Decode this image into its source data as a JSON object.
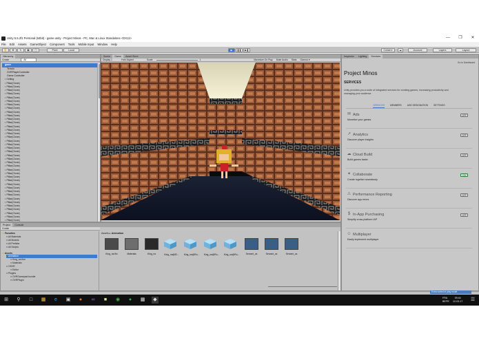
{
  "window": {
    "title": "Unity 5.5.2f1 Personal (64bit) - game.unity - Project Minos - PC, Mac & Linux Standalone <DX11>",
    "controls": [
      "—",
      "❐",
      "✕"
    ]
  },
  "menu": [
    "File",
    "Edit",
    "Assets",
    "GameObject",
    "Component",
    "Tools",
    "Mobile Input",
    "Window",
    "Help"
  ],
  "toolbar": {
    "pivot": "Pivot",
    "local": "Local",
    "collab": "Collab ▾",
    "account": "Account",
    "layers": "Layers",
    "layout": "Layout"
  },
  "hierarchy": {
    "tab": "Hierarchy",
    "create": "Create",
    "search_placeholder": "All",
    "scene": "game",
    "items": [
      "Terrain",
      "OVRPlayerController",
      "Game Controller",
      "Ceiling",
      "Pillar(Clone)",
      "Pillar(Clone)",
      "Pillar(Clone)",
      "Pillar(Clone)",
      "Pillar(Clone)",
      "Pillar(Clone)",
      "Pillar(Clone)",
      "Pillar(Clone)",
      "Pillar(Clone)",
      "Pillar(Clone)",
      "Pillar(Clone)",
      "Pillar(Clone)",
      "Pillar(Clone)",
      "Pillar(Clone)",
      "Pillar(Clone)",
      "Pillar(Clone)",
      "Pillar(Clone)",
      "Pillar(Clone)",
      "Pillar(Clone)",
      "Pillar(Clone)",
      "Pillar(Clone)",
      "Pillar(Clone)",
      "Pillar(Clone)",
      "Pillar(Clone)",
      "Pillar(Clone)",
      "Pillar(Clone)",
      "Pillar(Clone)",
      "Pillar(Clone)",
      "Pillar(Clone)",
      "Pillar(Clone)",
      "Pillar(Clone)",
      "Pillar(Clone)",
      "Pillar(Clone)",
      "Pillar(Clone)",
      "Pillar(Clone)",
      "Pillar(Clone)",
      "Pillar(Clone)",
      "Pillar(Clone)",
      "Pillar(Clone)"
    ]
  },
  "center": {
    "tabs": [
      "Scene",
      "Game",
      "Asset Store"
    ],
    "display": "Display 1",
    "aspect": "Free Aspect",
    "scale_label": "Scale",
    "scale_value": "1",
    "options": [
      "Maximize On Play",
      "Mute Audio",
      "Stats",
      "Gizmos ▾"
    ]
  },
  "right": {
    "tabs": [
      "Inspector",
      "Lighting",
      "Services"
    ],
    "go_to_dashboard": "Go to Dashboard",
    "project_name": "Project Minos",
    "section": "SERVICES",
    "intro": "Unity provides you a suite of integrated services for creating games, increasing productivity and managing your audience.",
    "subtabs": [
      "SERVICES",
      "MEMBERS",
      "AGE DESIGNATION",
      "SETTINGS"
    ],
    "services": [
      {
        "name": "Ads",
        "desc": "Monetize your games",
        "state": "OFF",
        "icon": "ads-icon"
      },
      {
        "name": "Analytics",
        "desc": "Discover player insights",
        "state": "OFF",
        "icon": "analytics-icon"
      },
      {
        "name": "Cloud Build",
        "desc": "Build games faster",
        "state": "OFF",
        "icon": "cloud-build-icon"
      },
      {
        "name": "Collaborate",
        "desc": "Create together seamlessly",
        "state": "ON",
        "icon": "collaborate-icon"
      },
      {
        "name": "Performance Reporting",
        "desc": "Discover app errors",
        "state": "OFF",
        "icon": "performance-icon"
      },
      {
        "name": "In-App Purchasing",
        "desc": "Simplify cross-platform IAP",
        "state": "OFF",
        "icon": "iap-icon"
      },
      {
        "name": "Multiplayer",
        "desc": "Easily implement multiplayer",
        "state": "",
        "icon": "multiplayer-icon"
      }
    ]
  },
  "project": {
    "tabs": [
      "Project",
      "Console"
    ],
    "create": "Create",
    "breadcrumb": [
      "Assets",
      "Animation"
    ],
    "favorites_header": "Favorites",
    "favorites": [
      "All Materials",
      "All Models",
      "All Prefabs",
      "All Scripts"
    ],
    "assets_header": "Assets",
    "folders": [
      "Animation",
      "King_na.fbm",
      "Materials",
      "OSVR",
      "Editor",
      "Plugins",
      "OVRGamepad.bundle",
      "OVRPlugin"
    ],
    "assets": [
      "King_na.fbx",
      "Materials",
      "King_na",
      "King_na@El...",
      "King_na@Ru...",
      "King_na@Ru...",
      "King_na@Ru...",
      "Servant_ca",
      "Servant_ca",
      "Servant_ca"
    ]
  },
  "taskbar": {
    "lang": "FRA",
    "layout": "BEFR",
    "time": "09:44",
    "date": "12-03-17",
    "notification": "Extra sorted in play mode"
  },
  "colors": {
    "editor_bg": "#c2c2c2",
    "selection": "#3e7ad0",
    "play_button": "#3c76c7",
    "taskbar": "#101010"
  }
}
